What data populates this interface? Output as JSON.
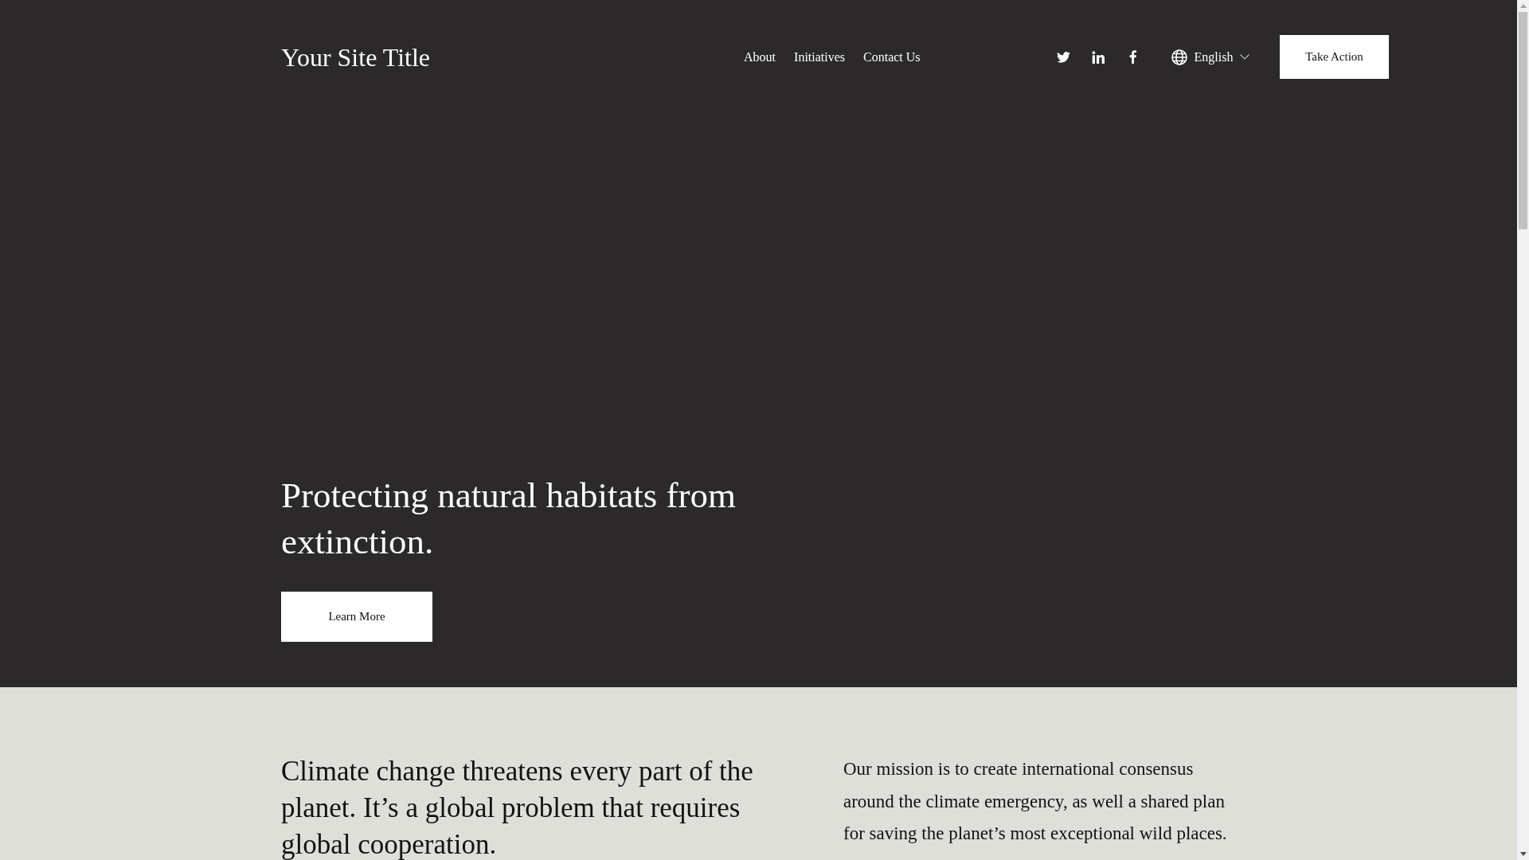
{
  "header": {
    "site_title": "Your Site Title",
    "nav_links": [
      "About",
      "Initiatives",
      "Contact Us"
    ],
    "language": "English",
    "action_button": "Take Action"
  },
  "hero": {
    "heading": "Protecting natural habitats from extinction.",
    "button": "Learn More"
  },
  "intro": {
    "heading": "Climate change threatens every part of the planet. It’s a global problem that requires global cooperation.",
    "body": "Our mission is to create international consensus around the climate emergency, as well a shared plan for saving the planet’s most exceptional wild places."
  }
}
